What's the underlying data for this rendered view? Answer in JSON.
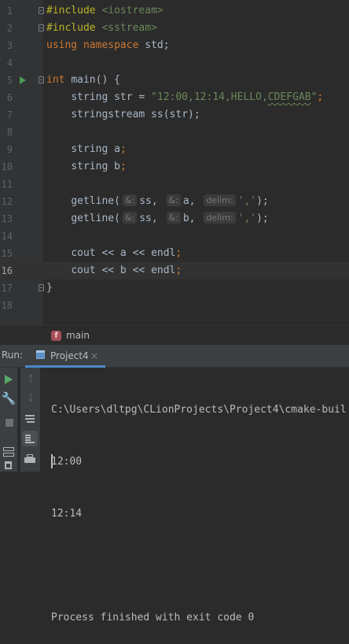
{
  "editor": {
    "current_line": 16,
    "lines": [
      {
        "num": "1"
      },
      {
        "num": "2"
      },
      {
        "num": "3"
      },
      {
        "num": "4"
      },
      {
        "num": "5"
      },
      {
        "num": "6"
      },
      {
        "num": "7"
      },
      {
        "num": "8"
      },
      {
        "num": "9"
      },
      {
        "num": "10"
      },
      {
        "num": "11"
      },
      {
        "num": "12"
      },
      {
        "num": "13"
      },
      {
        "num": "14"
      },
      {
        "num": "15"
      },
      {
        "num": "16"
      },
      {
        "num": "17"
      },
      {
        "num": "18"
      }
    ],
    "code": {
      "l1_directive": "#include",
      "l1_header": "<iostream>",
      "l2_directive": "#include",
      "l2_header": "<sstream>",
      "l3_kw1": "using",
      "l3_kw2": "namespace",
      "l3_rest": "std;",
      "l5_kw": "int",
      "l5_rest": "main() {",
      "l6_type": "string str = ",
      "l6_str": "\"12:00,12:14,HELLO,",
      "l6_str_wave": "CDEFGAB",
      "l6_str_end": "\"",
      "l6_semi": ";",
      "l7": "stringstream ss(str);",
      "l9_type": "string a",
      "l9_semi": ";",
      "l10_type": "string b",
      "l10_semi": ";",
      "l12_fn": "getline(",
      "l12_hint1": "&:",
      "l12_arg1": "ss,",
      "l12_hint2": "&:",
      "l12_arg2": "a,",
      "l12_hint3": "delim:",
      "l12_arg3": "','",
      "l12_end": ");",
      "l13_fn": "getline(",
      "l13_hint1": "&:",
      "l13_arg1": "ss,",
      "l13_hint2": "&:",
      "l13_arg2": "b,",
      "l13_hint3": "delim:",
      "l13_arg3": "','",
      "l13_end": ");",
      "l15_a": "cout ",
      "l15_op1": "<<",
      "l15_b": " a ",
      "l15_op2": "<<",
      "l15_c": " endl",
      "l15_semi": ";",
      "l16_a": "cout ",
      "l16_op1": "<<",
      "l16_b": " b ",
      "l16_op2": "<<",
      "l16_c": " endl",
      "l16_semi": ";",
      "l17": "}"
    }
  },
  "breadcrumb": {
    "badge": "f",
    "function": "main"
  },
  "run_panel": {
    "label": "Run:",
    "tab_label": "Project4",
    "tab_close": "×",
    "up_arrow": "↑",
    "down_arrow": "↓",
    "wrench": "🔧"
  },
  "console": {
    "lines": [
      "C:\\Users\\dltpg\\CLionProjects\\Project4\\cmake-buil",
      "12:00",
      "12:14",
      "",
      "Process finished with exit code 0"
    ]
  },
  "colors": {
    "background": "#2b2b2b",
    "gutter": "#313335",
    "panel": "#3c3f41",
    "keyword": "#cc7832",
    "string": "#6a8759",
    "directive": "#bbb529",
    "text": "#a9b7c6",
    "run_green": "#499c54",
    "tab_accent": "#4a88c7"
  }
}
